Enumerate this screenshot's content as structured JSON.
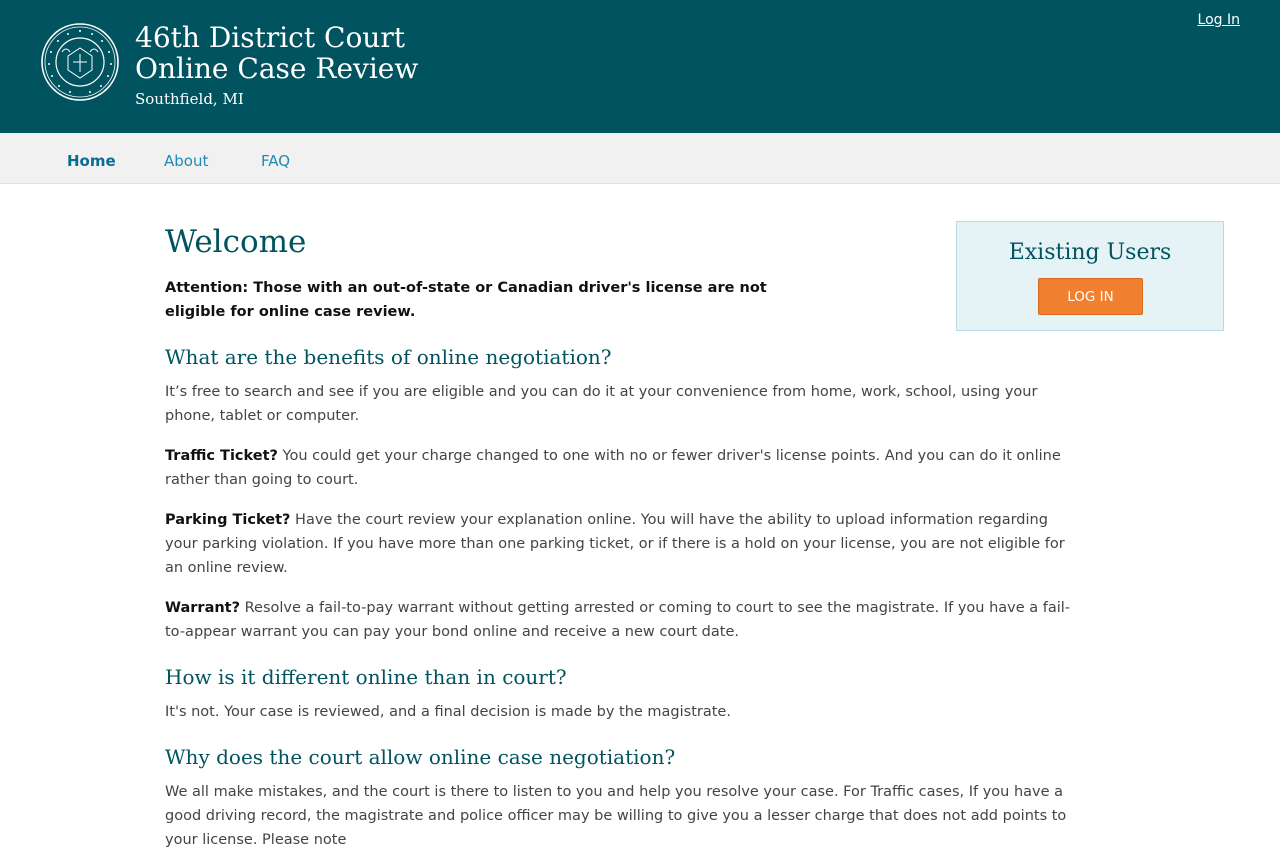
{
  "header": {
    "title_line1": "46th District Court",
    "title_line2": "Online Case Review",
    "subtitle": "Southfield, MI",
    "login_link": "Log In",
    "background_color": "#00535f",
    "seal_icon": "state-seal-icon"
  },
  "nav": {
    "items": [
      {
        "label": "Home"
      },
      {
        "label": "About"
      },
      {
        "label": "FAQ"
      }
    ],
    "active": "Home"
  },
  "main": {
    "heading": "Welcome",
    "attention": "Attention: Those with an out-of-state or Canadian driver's license are not eligible for online case review.",
    "section1_heading": "What are the benefits of online negotiation?",
    "section1_intro": "It’s free to search and see if you are eligible and you can do it at your convenience from home, work, school, using your phone, tablet or computer.",
    "traffic_label": "Traffic Ticket?",
    "traffic_text": " You could get your charge changed to one with no or fewer driver's license points. And you can do it online rather than going to court.",
    "parking_label": "Parking Ticket?",
    "parking_text": " Have the court review your explanation online. You will have the ability to upload information regarding your parking violation. If you have more than one parking ticket, or if there is a hold on your license, you are not eligible for an online review.",
    "warrant_label": "Warrant?",
    "warrant_text": " Resolve a fail-to-pay warrant without getting arrested or coming to court to see the magistrate. If you have a fail-to-appear warrant you can pay your bond online and receive a new court date.",
    "section2_heading": "How is it different online than in court?",
    "section2_text": "It's not. Your case is reviewed, and a final decision is made by the magistrate.",
    "section3_heading": "Why does the court allow online case negotiation?",
    "section3_text": "We all make mistakes, and the court is there to listen to you and help you resolve your case. For Traffic cases, If you have a good driving record, the magistrate and police officer may be willing to give you a lesser charge that does not add points to your license. Please note"
  },
  "sidebar": {
    "existing_title": "Existing Users",
    "login_button": "LOG IN",
    "accent_color": "#f0802f"
  }
}
